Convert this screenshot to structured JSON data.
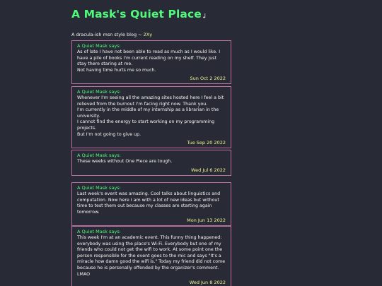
{
  "header": {
    "title": "A Mask's Quiet Place",
    "title_glyph": "𝆺𝅥",
    "tagline_prefix": "A dracula-ish msn style blog ~ ",
    "tagline_accent": "2Xy"
  },
  "posts": [
    {
      "author": "A Quiet Mask says:",
      "lines": [
        "As of late I have not been able to read as much as I would like. I have a pile of books I'm current reading on my shelf. They just stay there staring at me.",
        "Not having time hurts me so much."
      ],
      "date": "Sun Oct 2 2022"
    },
    {
      "author": "A Quiet Mask says:",
      "lines": [
        "Whenever I'm seeing all the amazing sites hosted here I feel a bit relieved from the burnout I'm facing right now. Thank you.",
        "I'm currently in the middle of my internship as a librarian in the university.",
        "I cannot find the energy to start working on my programming projects.",
        "But I'm not going to give up."
      ],
      "date": "Tue Sep 20 2022"
    },
    {
      "author": "A Quiet Mask says:",
      "lines": [
        "These weeks without One Piece are tough."
      ],
      "date": "Wed Jul 6 2022"
    },
    {
      "author": "A Quiet Mask says:",
      "lines": [
        "Last week's event was amazing. Cool talks about linguistics and computation. Now here I am with a lot of new ideas but without time to test them out because my classes are starting again tomorrow."
      ],
      "date": "Mon Jun 13 2022"
    },
    {
      "author": "A Quiet Mask says:",
      "lines": [
        "This week I'm at an academic event. This funny thing happened: everybody was using the place's Wi-Fi. Everybody but one of my friends who could not get the wifi to work. At some point one the person responsible for the event goes to the mic and says \"It's a miracle how damn good the wifi is.\" Today my friend did not come because he is personally offended by the organizer's comment. LMAO"
      ],
      "date": "Wed Jun 8 2022"
    }
  ]
}
